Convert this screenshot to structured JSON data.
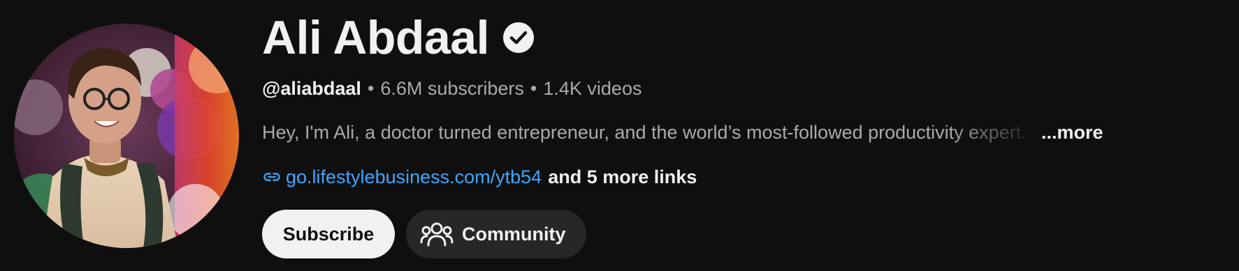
{
  "channel": {
    "name": "Ali Abdaal",
    "verified": true,
    "handle": "@aliabdaal",
    "separator": "•",
    "subscribers": "6.6M subscribers",
    "videos": "1.4K videos",
    "description": "Hey, I'm Ali, a doctor turned entrepreneur, and the world’s most-followed productivity expert.",
    "description_more": "...more",
    "link_url": "go.lifestylebusiness.com/ytb54",
    "more_links": "and 5 more links"
  },
  "actions": {
    "subscribe_label": "Subscribe",
    "community_label": "Community"
  },
  "icons": {
    "verified": "verified-check-icon",
    "link": "link-icon",
    "community": "people-icon"
  },
  "colors": {
    "background": "#0f0f0f",
    "text_primary": "#f1f1f1",
    "text_secondary": "#aaaaaa",
    "link": "#3ea6ff",
    "subscribe_bg": "#f1f1f1",
    "community_bg": "#272727"
  }
}
